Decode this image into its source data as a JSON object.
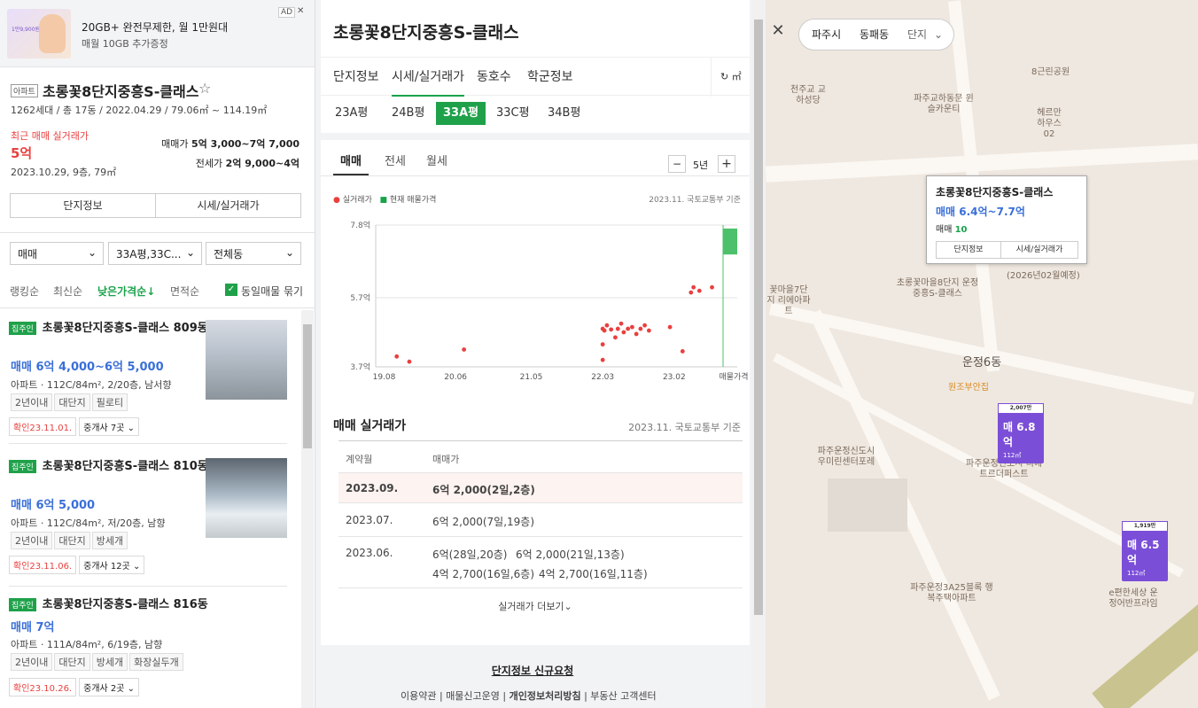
{
  "ad": {
    "badge": "AD",
    "close": "✕",
    "title": "20GB+ 완전무제한, 월 1만원대",
    "sub": "매월 10GB 추가증정",
    "thumb_text": "1만9,900원"
  },
  "complex": {
    "type": "아파트",
    "name": "초롱꽃8단지중흥S-클래스",
    "star": "☆",
    "info": "1262세대 / 총 17동 / 2022.04.29 / 79.06㎡ ~ 114.19㎡",
    "recent_label": "최근 매매 실거래가",
    "recent_price": "5억",
    "recent_meta": "2023.10.29, 9층, 79㎡",
    "sale_label": "매매가",
    "sale_value": "5억 3,000~7억 7,000",
    "jeonse_label": "전세가",
    "jeonse_value": "2억 9,000~4억",
    "btn_info": "단지정보",
    "btn_price": "시세/실거래가"
  },
  "filters": {
    "deal": "매매",
    "size": "33A평,33C...",
    "dong": "전체동",
    "sort": [
      "랭킹순",
      "최신순",
      "낮은가격순↓",
      "면적순"
    ],
    "group_label": "동일매물 묶기",
    "group_checked": true
  },
  "listings": [
    {
      "owner": "집주인",
      "title": "초롱꽃8단지중흥S-클래스 809동",
      "price": "매매 6억 4,000~6억 5,000",
      "spec": "아파트 · 112C/84m², 2/20층, 남서향",
      "tags": [
        "2년이내",
        "대단지",
        "필로티"
      ],
      "confirm": "확인23.11.01.",
      "agents": "중개사 7곳"
    },
    {
      "owner": "집주인",
      "title": "초롱꽃8단지중흥S-클래스 810동",
      "price": "매매 6억 5,000",
      "spec": "아파트 · 112C/84m², 저/20층, 남향",
      "tags": [
        "2년이내",
        "대단지",
        "방세개"
      ],
      "confirm": "확인23.11.06.",
      "agents": "중개사 12곳"
    },
    {
      "owner": "집주인",
      "title": "초롱꽃8단지중흥S-클래스 816동",
      "price": "매매 7억",
      "spec": "아파트 · 111A/84m², 6/19층, 남향",
      "tags": [
        "2년이내",
        "대단지",
        "방세개",
        "화장실두개"
      ],
      "confirm": "확인23.10.26.",
      "agents": "중개사 2곳"
    }
  ],
  "detail": {
    "title": "초롱꽃8단지중흥S-클래스",
    "tabs": [
      "단지정보",
      "시세/실거래가",
      "동호수",
      "학군정보"
    ],
    "unit": "↻ ㎡",
    "pyeong": [
      "23A평",
      "24B평",
      "33A평",
      "33C평",
      "34B평"
    ],
    "deal_tabs": [
      "매매",
      "전세",
      "월세"
    ],
    "period": "5년",
    "minus": "−",
    "plus": "+",
    "legend_actual": "실거래가",
    "legend_current": "현재 매물가격",
    "source": "2023.11. 국토교통부 기준"
  },
  "chart_data": {
    "type": "scatter",
    "y_ticks": [
      "7.8억",
      "5.7억",
      "3.7억"
    ],
    "x_ticks": [
      "19.08",
      "20.06",
      "21.05",
      "22.03",
      "23.02",
      "매물가격"
    ],
    "ylim": [
      3.7,
      7.8
    ],
    "series": [
      {
        "name": "실거래가",
        "points": [
          [
            2019.75,
            4.0
          ],
          [
            2019.9,
            3.85
          ],
          [
            2020.55,
            4.2
          ],
          [
            2022.2,
            4.8
          ],
          [
            2022.22,
            4.75
          ],
          [
            2022.25,
            4.9
          ],
          [
            2022.3,
            4.78
          ],
          [
            2022.35,
            4.55
          ],
          [
            2022.38,
            4.8
          ],
          [
            2022.42,
            4.95
          ],
          [
            2022.45,
            4.7
          ],
          [
            2022.5,
            4.8
          ],
          [
            2022.55,
            4.85
          ],
          [
            2022.6,
            4.65
          ],
          [
            2022.65,
            4.8
          ],
          [
            2022.7,
            4.9
          ],
          [
            2022.75,
            4.75
          ],
          [
            2022.2,
            4.35
          ],
          [
            2022.2,
            3.9
          ],
          [
            2023.0,
            4.85
          ],
          [
            2023.15,
            4.15
          ],
          [
            2023.25,
            5.85
          ],
          [
            2023.28,
            6.0
          ],
          [
            2023.35,
            5.9
          ],
          [
            2023.5,
            6.0
          ]
        ]
      },
      {
        "name": "현재 매물가격",
        "range": [
          6.95,
          7.7
        ]
      }
    ]
  },
  "trades": {
    "title": "매매 실거래가",
    "source": "2023.11. 국토교통부 기준",
    "col_date": "계약월",
    "col_price": "매매가",
    "rows": [
      {
        "date": "2023.09.",
        "items": [
          "6억 2,000(2일,2층)"
        ]
      },
      {
        "date": "2023.07.",
        "items": [
          "6억 2,000(7일,19층)"
        ]
      },
      {
        "date": "2023.06.",
        "items": [
          "6억(28일,20층)",
          "6억 2,000(21일,13층)",
          "4억 2,700(16일,6층)",
          "4억 2,700(16일,11층)"
        ]
      }
    ],
    "more": "실거래가 더보기⌄"
  },
  "footer": {
    "request": "단지정보 신규요청",
    "links": [
      "이용약관",
      "매물신고운영",
      "개인정보처리방침",
      "부동산 고객센터"
    ]
  },
  "map": {
    "crumbs": [
      "파주시",
      "동패동",
      "단지"
    ],
    "popup": {
      "name": "초롱꽃8단지중흥S-클래스",
      "price": "매매 6.4억~7.7억",
      "count_label": "매매",
      "count": "10",
      "btn_info": "단지정보",
      "btn_price": "시세/실거래가"
    },
    "labels": [
      {
        "t": "8근린공원"
      },
      {
        "t": "파주교하동문 윈슬카운티"
      },
      {
        "t": "천주교 교하성당"
      },
      {
        "t": "헤르만 하우스02"
      },
      {
        "t": "초롱꽃마을8단지 운정중흥S-클래스"
      },
      {
        "t": "꽃마을7단지 리에아파트"
      },
      {
        "t": "(2026년02월예정)"
      },
      {
        "t": "운정6동"
      },
      {
        "t": "원조부안집"
      },
      {
        "t": "파주운정신도시 우미린센터포레"
      },
      {
        "t": "파주운정신도시 디에트르더퍼스트"
      },
      {
        "t": "파주운정3A25블록 행복주택아파트"
      },
      {
        "t": "e편한세상 운정어반프라임"
      }
    ],
    "markers": [
      {
        "top": "2,007만",
        "label": "매 6.8억",
        "area": "112㎡"
      },
      {
        "top": "1,919만",
        "label": "매 6.5억",
        "area": "112㎡"
      }
    ]
  }
}
